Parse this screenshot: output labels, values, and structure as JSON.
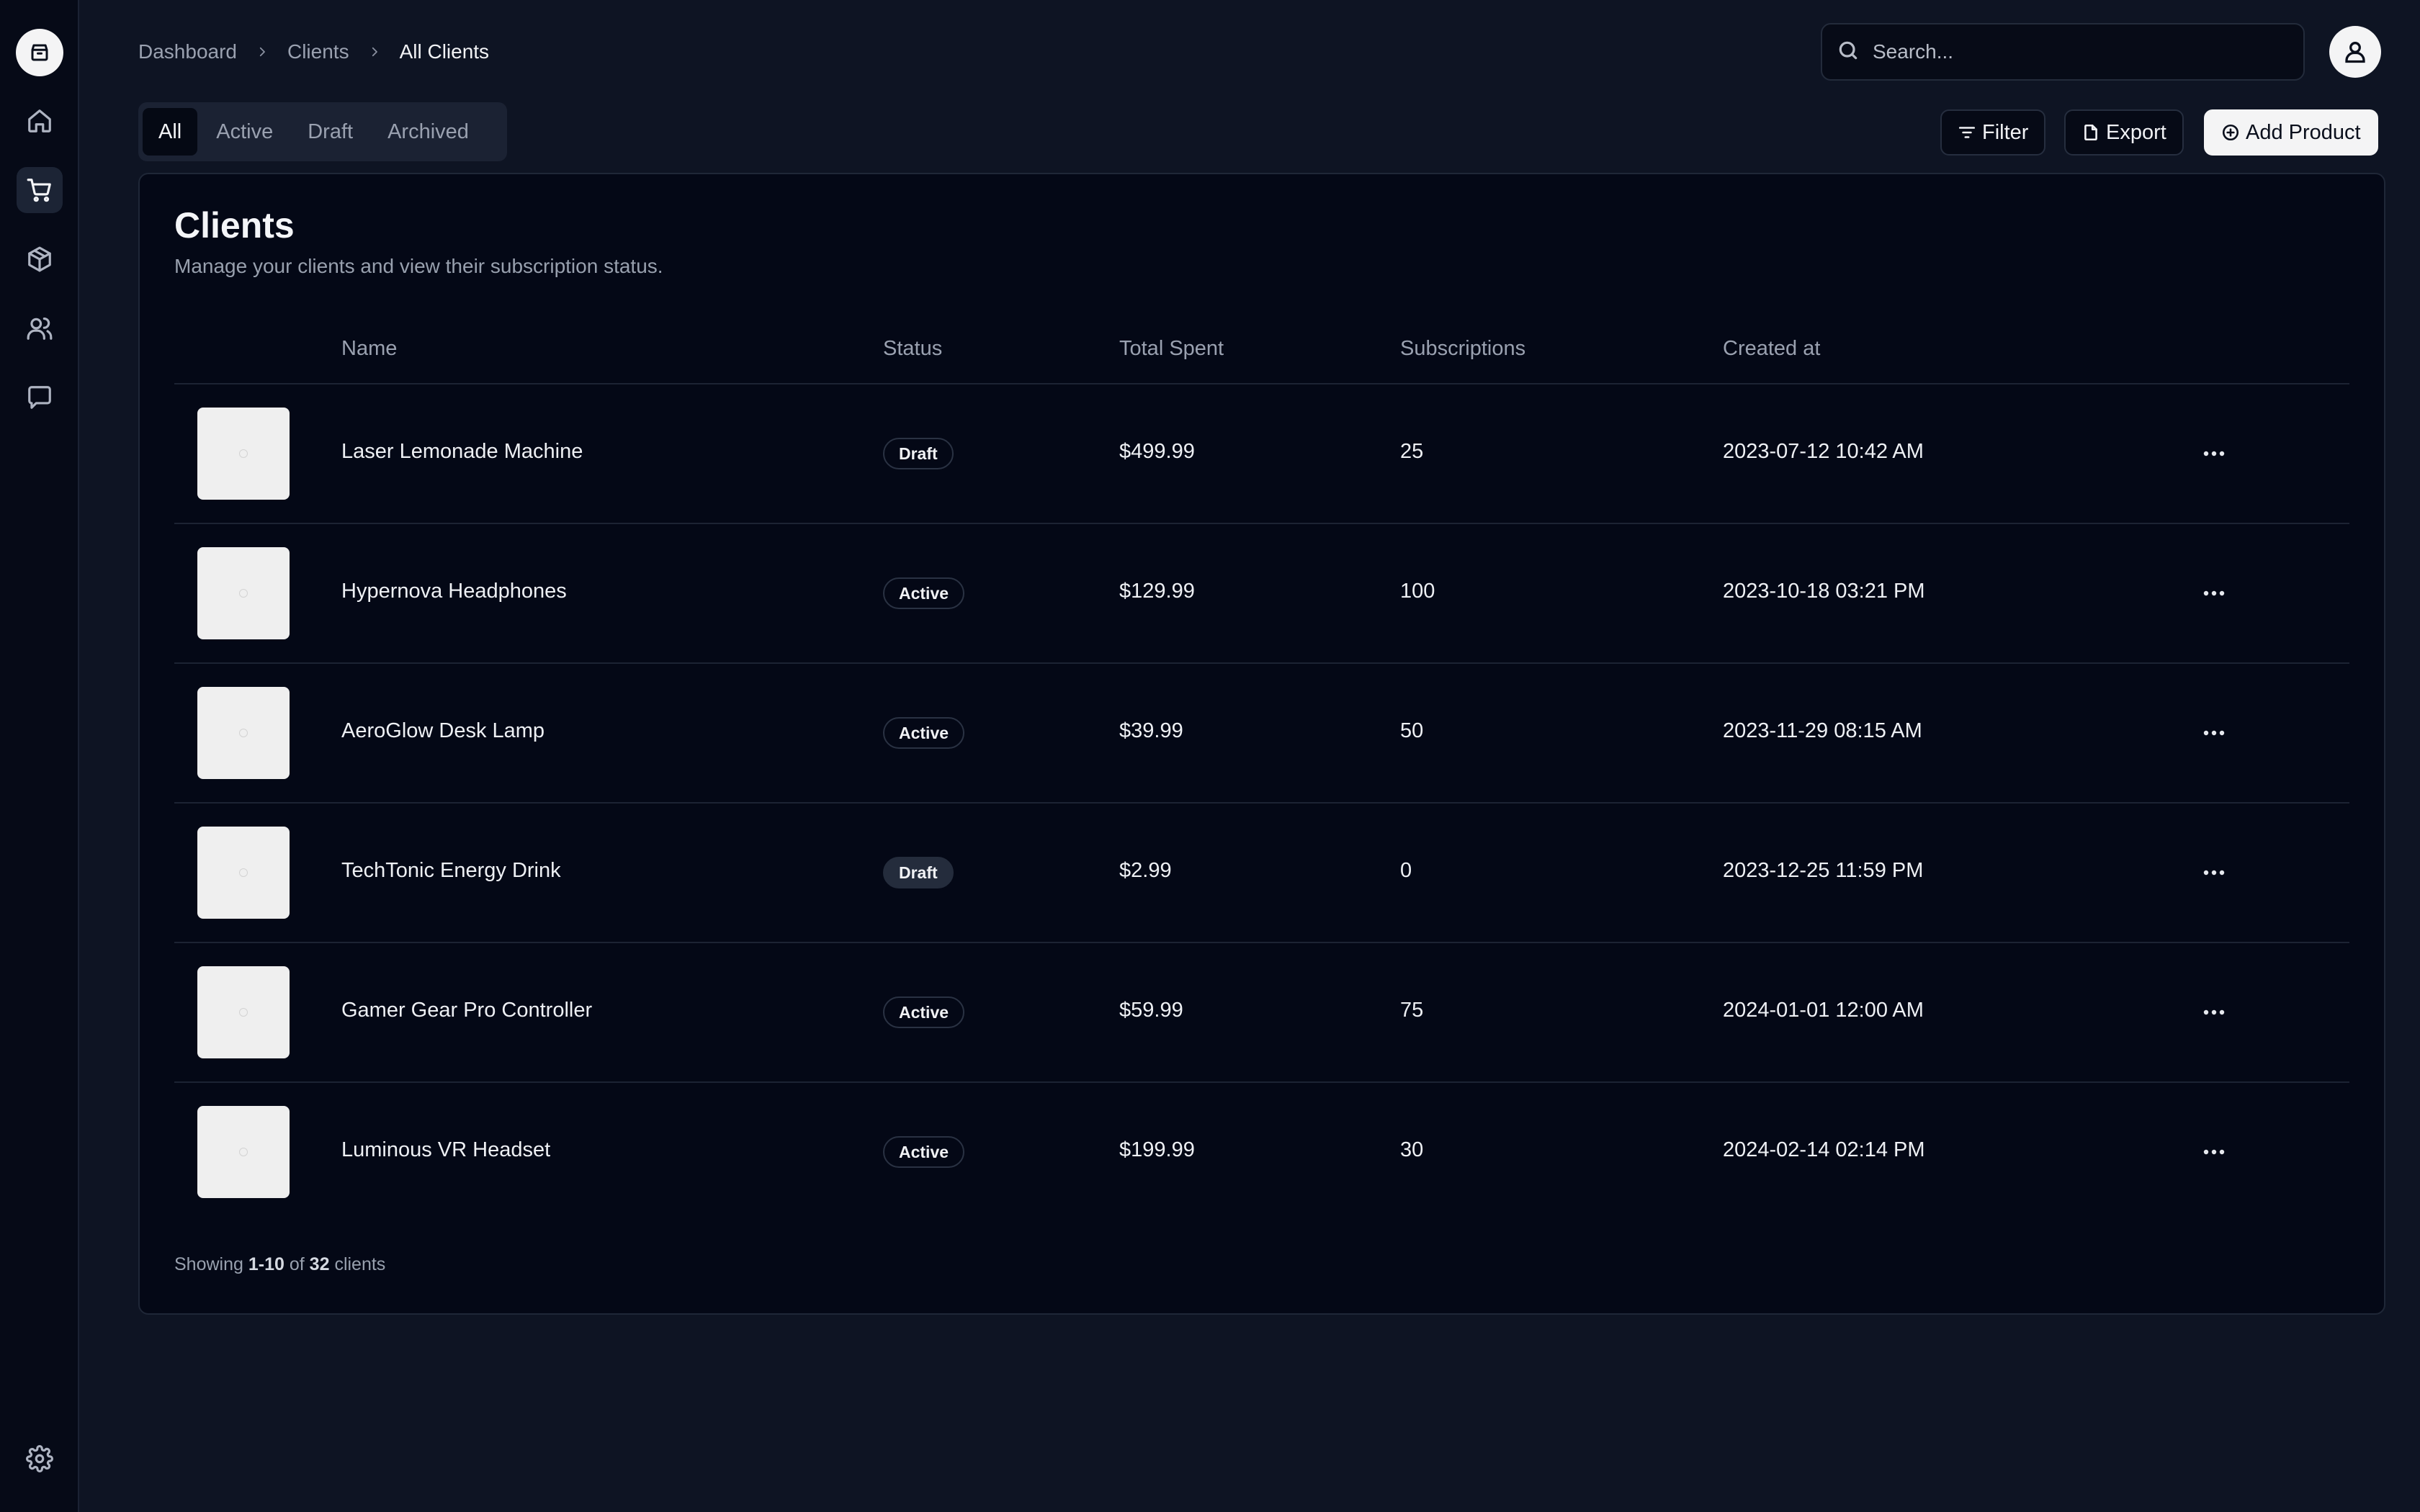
{
  "breadcrumb": [
    "Dashboard",
    "Clients",
    "All Clients"
  ],
  "search": {
    "placeholder": "Search..."
  },
  "tabs": [
    "All",
    "Active",
    "Draft",
    "Archived"
  ],
  "actions": {
    "filter": "Filter",
    "export": "Export",
    "add": "Add Product"
  },
  "card": {
    "title": "Clients",
    "description": "Manage your clients and view their subscription status."
  },
  "table": {
    "headers": [
      "Name",
      "Status",
      "Total Spent",
      "Subscriptions",
      "Created at"
    ],
    "rows": [
      {
        "name": "Laser Lemonade Machine",
        "status": "Draft",
        "total": "$499.99",
        "subs": "25",
        "created": "2023-07-12 10:42 AM"
      },
      {
        "name": "Hypernova Headphones",
        "status": "Active",
        "total": "$129.99",
        "subs": "100",
        "created": "2023-10-18 03:21 PM"
      },
      {
        "name": "AeroGlow Desk Lamp",
        "status": "Active",
        "total": "$39.99",
        "subs": "50",
        "created": "2023-11-29 08:15 AM"
      },
      {
        "name": "TechTonic Energy Drink",
        "status": "Draft",
        "total": "$2.99",
        "subs": "0",
        "created": "2023-12-25 11:59 PM"
      },
      {
        "name": "Gamer Gear Pro Controller",
        "status": "Active",
        "total": "$59.99",
        "subs": "75",
        "created": "2024-01-01 12:00 AM"
      },
      {
        "name": "Luminous VR Headset",
        "status": "Active",
        "total": "$199.99",
        "subs": "30",
        "created": "2024-02-14 02:14 PM"
      }
    ]
  },
  "footer": {
    "prefix": "Showing",
    "range": "1-10",
    "of": "of",
    "total": "32",
    "suffix": "clients"
  },
  "colors": {
    "background": "#0e1423",
    "card": "#040816",
    "accent": "#f4f4f5",
    "muted_text": "#9aa1b0"
  },
  "icons": {
    "sidebar": [
      "store-logo-icon",
      "home-icon",
      "shopping-cart-icon",
      "package-icon",
      "users-icon",
      "message-icon",
      "settings-icon"
    ],
    "header": [
      "search-icon",
      "user-icon"
    ]
  }
}
